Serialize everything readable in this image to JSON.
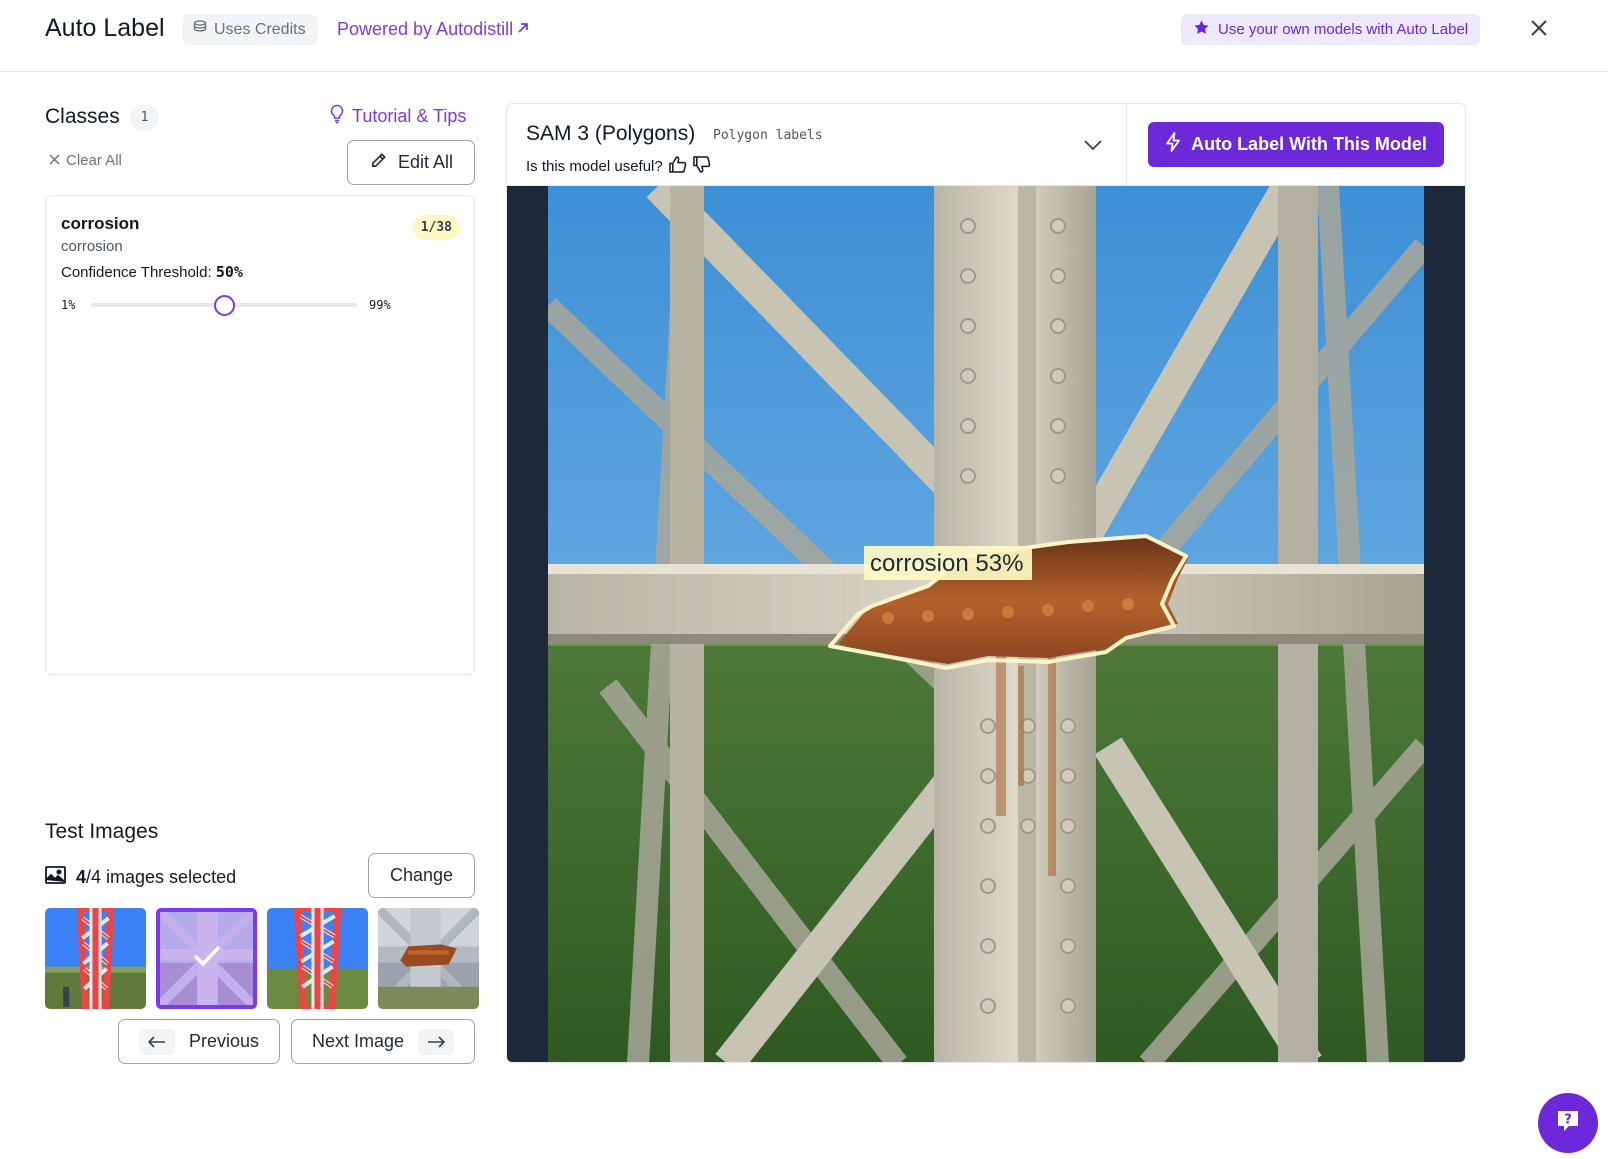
{
  "header": {
    "title": "Auto Label",
    "credits_badge": "Uses Credits",
    "powered_by": "Powered by Autodistill",
    "own_models_badge": "Use your own models with Auto Label"
  },
  "classes": {
    "title": "Classes",
    "count": "1",
    "tutorial_link": "Tutorial & Tips",
    "clear_all": "Clear All",
    "edit_all": "Edit All",
    "items": [
      {
        "name": "corrosion",
        "subtitle": "corrosion",
        "ratio": "1/38",
        "threshold_label": "Confidence Threshold:",
        "threshold_value": "50%",
        "threshold_fraction": 0.5,
        "slider_min": "1%",
        "slider_max": "99%"
      }
    ]
  },
  "test_images": {
    "title": "Test Images",
    "selected_count": "4",
    "selected_suffix": "/4 images selected",
    "change_label": "Change",
    "previous_label": "Previous",
    "next_label": "Next Image",
    "thumbnails": [
      {
        "kind": "tower-red",
        "selected": false
      },
      {
        "kind": "beam-steel",
        "selected": true
      },
      {
        "kind": "tower-red",
        "selected": false
      },
      {
        "kind": "rust-joint",
        "selected": false
      }
    ]
  },
  "model": {
    "name": "SAM 3 (Polygons)",
    "tag": "Polygon labels",
    "useful_question": "Is this model useful?",
    "auto_label_button": "Auto Label With This Model",
    "detection_label": "corrosion 53%"
  },
  "colors": {
    "accent": "#6d28d9",
    "accent_text": "#7c3aed",
    "badge_yellow": "#fef9c3",
    "polygon_stroke": "#fef3c7",
    "image_background": "#1e293b"
  },
  "icons": [
    "stack-coins-icon",
    "external-link-icon",
    "star-icon",
    "close-icon",
    "lightbulb-icon",
    "x-icon",
    "pencil-icon",
    "image-icon",
    "check-icon",
    "arrow-left-icon",
    "arrow-right-icon",
    "thumbs-up-icon",
    "thumbs-down-icon",
    "chevron-down-icon",
    "bolt-icon",
    "help-chat-icon"
  ]
}
